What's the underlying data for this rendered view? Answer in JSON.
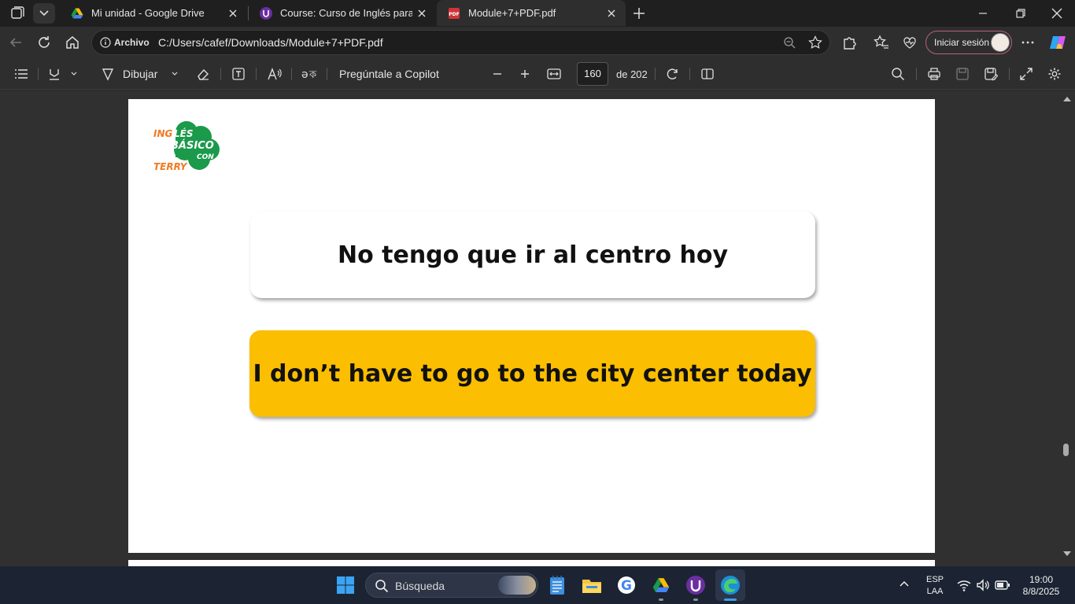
{
  "browser": {
    "tabs": [
      {
        "title": "Mi unidad - Google Drive",
        "icon": "google-drive-icon",
        "active": false
      },
      {
        "title": "Course: Curso de Inglés para principiantes",
        "icon": "course-icon",
        "active": false
      },
      {
        "title": "Module+7+PDF.pdf",
        "icon": "pdf-icon",
        "active": true
      }
    ],
    "address": {
      "scheme_label": "Archivo",
      "url": "C:/Users/cafef/Downloads/Module+7+PDF.pdf"
    },
    "signin_label": "Iniciar sesión"
  },
  "pdf_toolbar": {
    "draw_label": "Dibujar",
    "copilot_label": "Pregúntale a Copilot",
    "page_current": "160",
    "page_total_label": "de 202"
  },
  "document": {
    "logo": {
      "line1": "INGLÉS",
      "line2": "BÁSICO",
      "line3": "CON",
      "line4": "TERRY"
    },
    "card1_text": "No tengo que ir al centro hoy",
    "card2_text": "I don’t have to go to the city center today"
  },
  "taskbar": {
    "search_placeholder": "Búsqueda",
    "lang_line1": "ESP",
    "lang_line2": "LAA",
    "time": "19:00",
    "date": "8/8/2025"
  },
  "colors": {
    "card_highlight": "#fbbe00",
    "logo_green": "#1a9a4a",
    "logo_orange": "#f07a22",
    "edge_accent": "#3b9fe8"
  }
}
